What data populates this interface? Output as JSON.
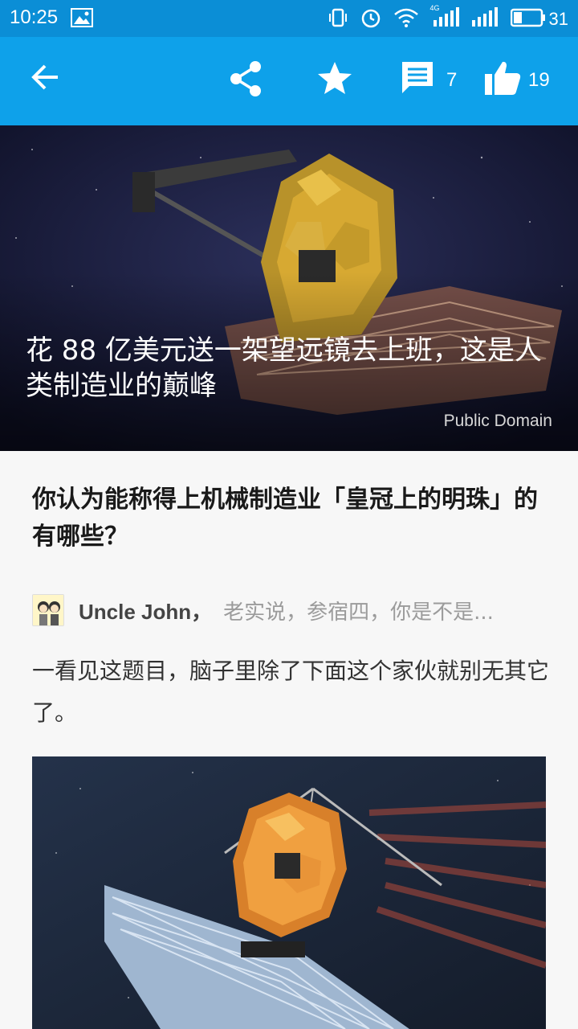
{
  "status_bar": {
    "time": "10:25",
    "network": "4G",
    "battery": "31"
  },
  "toolbar": {
    "comment_count": "7",
    "like_count": "19"
  },
  "hero": {
    "title": "花 88 亿美元送一架望远镜去上班，这是人类制造业的巅峰",
    "credit": "Public Domain"
  },
  "question": {
    "title": "你认为能称得上机械制造业「皇冠上的明珠」的有哪些？"
  },
  "answer": {
    "author_name": "Uncle John，",
    "author_bio": "老实说，参宿四，你是不是...",
    "text": "一看见这题目，脑子里除了下面这个家伙就别无其它了。"
  },
  "colors": {
    "status_bar": "#0b8ed6",
    "toolbar": "#0ea1ea"
  }
}
